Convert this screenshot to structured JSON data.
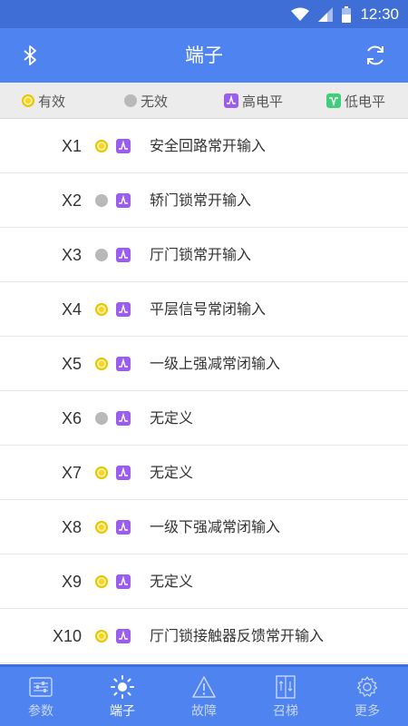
{
  "status_bar": {
    "time": "12:30"
  },
  "app_bar": {
    "title": "端子",
    "left_icon": "bluetooth-icon",
    "right_icon": "refresh-icon"
  },
  "legend": {
    "items": [
      {
        "label": "有效",
        "icon": "yellow-dot"
      },
      {
        "label": "无效",
        "icon": "gray-dot"
      },
      {
        "label": "高电平",
        "icon": "purple-wave"
      },
      {
        "label": "低电平",
        "icon": "green-wave"
      }
    ]
  },
  "terminals": [
    {
      "code": "X1",
      "state": "active",
      "level": "high",
      "desc": "安全回路常开输入"
    },
    {
      "code": "X2",
      "state": "inactive",
      "level": "high",
      "desc": "轿门锁常开输入"
    },
    {
      "code": "X3",
      "state": "inactive",
      "level": "high",
      "desc": "厅门锁常开输入"
    },
    {
      "code": "X4",
      "state": "active",
      "level": "high",
      "desc": "平层信号常闭输入"
    },
    {
      "code": "X5",
      "state": "active",
      "level": "high",
      "desc": "一级上强减常闭输入"
    },
    {
      "code": "X6",
      "state": "inactive",
      "level": "high",
      "desc": "无定义"
    },
    {
      "code": "X7",
      "state": "active",
      "level": "high",
      "desc": "无定义"
    },
    {
      "code": "X8",
      "state": "active",
      "level": "high",
      "desc": "一级下强减常闭输入"
    },
    {
      "code": "X9",
      "state": "active",
      "level": "high",
      "desc": "无定义"
    },
    {
      "code": "X10",
      "state": "active",
      "level": "high",
      "desc": "厅门锁接触器反馈常开输入"
    }
  ],
  "bottom_nav": {
    "items": [
      {
        "label": "参数",
        "icon": "sliders-icon",
        "active": false
      },
      {
        "label": "端子",
        "icon": "sun-icon",
        "active": true
      },
      {
        "label": "故障",
        "icon": "warning-icon",
        "active": false
      },
      {
        "label": "召梯",
        "icon": "elevator-icon",
        "active": false
      },
      {
        "label": "更多",
        "icon": "gear-icon",
        "active": false
      }
    ]
  },
  "colors": {
    "primary": "#4f84f0",
    "active_dot": "#f7d51e",
    "inactive_dot": "#b9b9b9",
    "high_level": "#9b5cf0",
    "low_level": "#3fcf7a"
  }
}
